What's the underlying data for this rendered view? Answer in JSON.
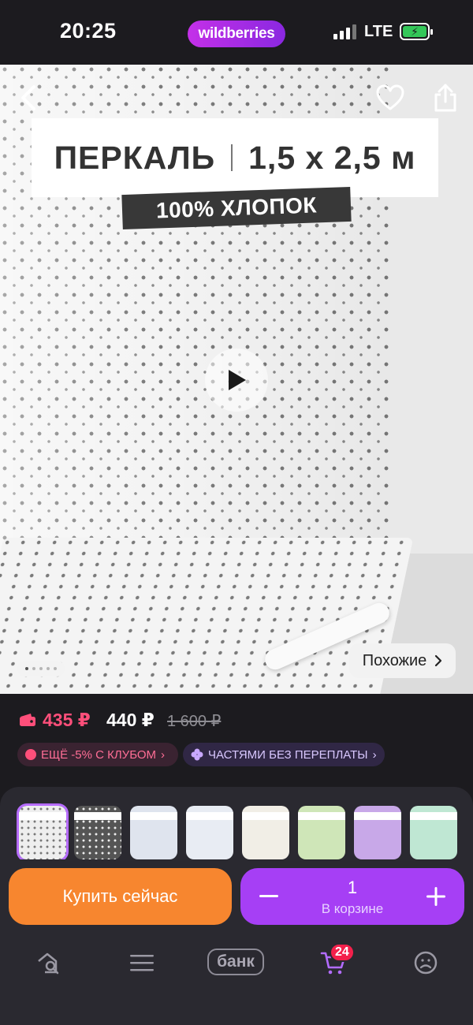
{
  "status_bar": {
    "time": "20:25",
    "brand": "wildberries",
    "network": "LTE"
  },
  "product": {
    "title_left": "ПЕРКАЛЬ",
    "title_right": "1,5 х 2,5 м",
    "badge": "100% ХЛОПОК"
  },
  "hero": {
    "similar_label": "Похожие",
    "carousel": {
      "total": 5,
      "active": 1
    }
  },
  "price": {
    "wallet_price": "435 ₽",
    "price": "440 ₽",
    "old_price": "1 600 ₽",
    "chips": {
      "club": "ЕЩЁ -5% С КЛУБОМ",
      "installments": "ЧАСТЯМИ БЕЗ ПЕРЕПЛАТЫ"
    }
  },
  "thumbnails": [
    {
      "label": "ПЕРКАЛЬ 1,5 х 2,5 м",
      "selected": true
    },
    {
      "label": "ПЕРКАЛЬ 1,5 х 2,5 м",
      "selected": false
    },
    {
      "label": "ПЕРКАЛЬ",
      "selected": false
    },
    {
      "label": "ПЕРКАЛЬ",
      "selected": false
    },
    {
      "label": "ПЕРКАЛЬ 0,7 х 1,4 м",
      "selected": false
    },
    {
      "label": "ПЕРКАЛЬ 1,5 х 2,5 м",
      "selected": false
    },
    {
      "label": "ПЕРКАЛЬ 1,5 х 2,5 м",
      "selected": false
    },
    {
      "label": "ПЕРКАЛЬ 1,5 х 2,5 м",
      "selected": false
    }
  ],
  "actions": {
    "buy_now": "Купить сейчас",
    "quantity": "1",
    "in_cart": "В корзине"
  },
  "bottom_nav": {
    "bank": "банк",
    "cart_count": "24"
  },
  "colors": {
    "accent_purple": "#a63ff5",
    "buy_orange": "#f7862f",
    "wallet_pink": "#ff4f7a",
    "badge_red": "#f3204b"
  }
}
